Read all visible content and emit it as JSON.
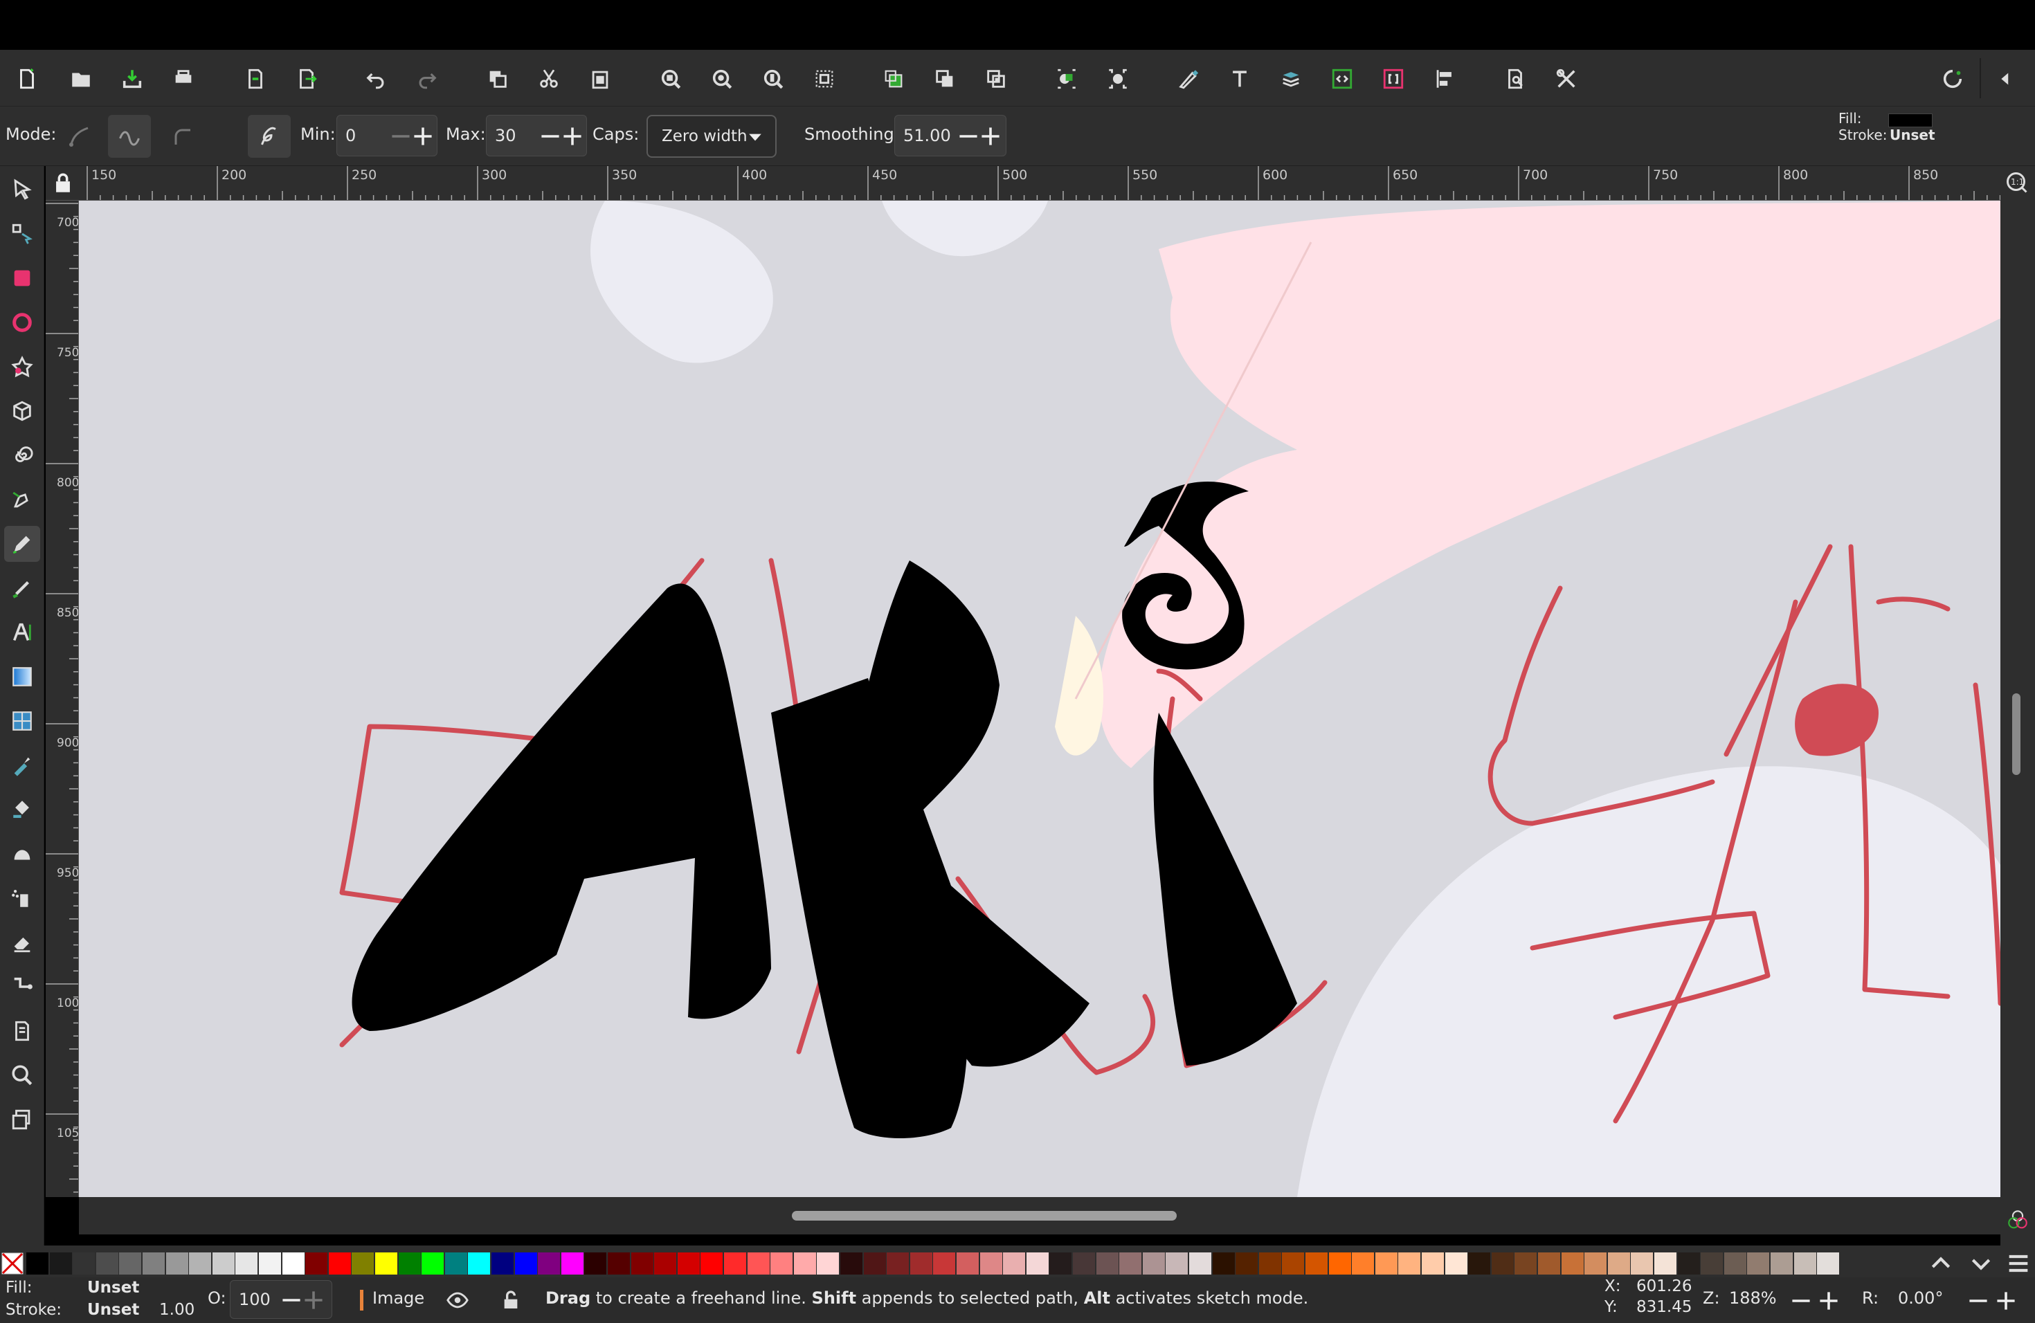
{
  "colors": {
    "bg": "#2e2e2e",
    "canvas": "#d8d8de",
    "accent_pink": "#e8336f",
    "stroke_red": "#d04b55",
    "fill_black": "#000000"
  },
  "command_bar": {
    "icons": [
      "new-document-icon",
      "open-file-icon",
      "save-icon",
      "print-icon",
      "import-icon",
      "export-icon",
      "undo-icon",
      "redo-icon",
      "copy-icon",
      "cut-icon",
      "paste-icon",
      "zoom-selection-icon",
      "zoom-drawing-icon",
      "zoom-page-icon",
      "zoom-page-width-icon",
      "duplicate-icon",
      "clone-icon",
      "unlink-clone-icon",
      "group-icon",
      "ungroup-icon",
      "fill-stroke-icon",
      "text-font-icon",
      "layers-icon",
      "xml-editor-icon",
      "selectors-icon",
      "align-distribute-icon",
      "document-properties-icon",
      "preferences-icon",
      "snap-toggle-icon",
      "collapse-panel-icon"
    ]
  },
  "controls": {
    "mode_label": "Mode:",
    "min_label": "Min:",
    "min_value": "0",
    "max_label": "Max:",
    "max_value": "30",
    "caps_label": "Caps:",
    "caps_value": "Zero width",
    "smoothing_label": "Smoothing:",
    "smoothing_value": "51.00",
    "fill_label": "Fill:",
    "stroke_label": "Stroke:",
    "stroke_value": "Unset"
  },
  "ruler": {
    "h_labels": [
      "150",
      "200",
      "250",
      "300",
      "350",
      "400",
      "450",
      "500",
      "550",
      "600",
      "650",
      "700",
      "750",
      "800",
      "850"
    ],
    "v_labels": [
      "700",
      "750",
      "800",
      "850",
      "900",
      "950",
      "1000",
      "1050"
    ]
  },
  "tools": [
    "selector-tool-icon",
    "node-tool-icon",
    "rectangle-tool-icon",
    "ellipse-tool-icon",
    "star-tool-icon",
    "box3d-tool-icon",
    "spiral-tool-icon",
    "pen-tool-icon",
    "pencil-tool-icon",
    "calligraphy-tool-icon",
    "text-tool-icon",
    "gradient-tool-icon",
    "mesh-tool-icon",
    "dropper-tool-icon",
    "paint-bucket-tool-icon",
    "tweak-tool-icon",
    "spray-tool-icon",
    "eraser-tool-icon",
    "connector-tool-icon",
    "pages-tool-icon",
    "zoom-tool-icon",
    "measure-tool-icon"
  ],
  "palette": {
    "swatches": [
      "#000000",
      "#1a1a1a",
      "#333333",
      "#4d4d4d",
      "#666666",
      "#808080",
      "#999999",
      "#b3b3b3",
      "#cccccc",
      "#e6e6e6",
      "#f2f2f2",
      "#ffffff",
      "#800000",
      "#ff0000",
      "#808000",
      "#ffff00",
      "#008000",
      "#00ff00",
      "#008080",
      "#00ffff",
      "#000080",
      "#0000ff",
      "#800080",
      "#ff00ff",
      "#2b0000",
      "#550000",
      "#800000",
      "#aa0000",
      "#d40000",
      "#ff0000",
      "#ff2a2a",
      "#ff5555",
      "#ff8080",
      "#ffaaaa",
      "#ffd5d5",
      "#280b0b",
      "#501616",
      "#782121",
      "#a02c2c",
      "#c83737",
      "#d35f5f",
      "#de8787",
      "#e9afaf",
      "#f4d7d7",
      "#241c1c",
      "#483737",
      "#6c5353",
      "#916f6f",
      "#ac9393",
      "#c8b7b7",
      "#e3dbdb",
      "#2b1100",
      "#552200",
      "#803300",
      "#aa4400",
      "#d45500",
      "#ff6600",
      "#ff7f2a",
      "#ff9955",
      "#ffb380",
      "#ffccaa",
      "#ffe6d5",
      "#28170b",
      "#502d16",
      "#784421",
      "#a05a2c",
      "#c87137",
      "#d38d5f",
      "#deaa87",
      "#e9c6af",
      "#f4e3d7",
      "#241f1c",
      "#483e37",
      "#6c5d53",
      "#917c6f",
      "#ac9d93",
      "#c8beb7",
      "#e3dedb"
    ]
  },
  "status": {
    "fill_label": "Fill:",
    "fill_value": "Unset",
    "stroke_label": "Stroke:",
    "stroke_value": "Unset",
    "stroke_width": "1.00",
    "opacity_label": "O:",
    "opacity_value": "100",
    "layer_name": "Image",
    "message_drag": "Drag",
    "message_1": " to create a freehand line. ",
    "message_shift": "Shift",
    "message_2": " appends to selected path, ",
    "message_alt": "Alt",
    "message_3": " activates sketch mode.",
    "x_label": "X:",
    "x_value": "601.26",
    "y_label": "Y:",
    "y_value": "831.45",
    "zoom_label": "Z:",
    "zoom_value": "188%",
    "rotation_label": "R:",
    "rotation_value": "0.00°"
  }
}
